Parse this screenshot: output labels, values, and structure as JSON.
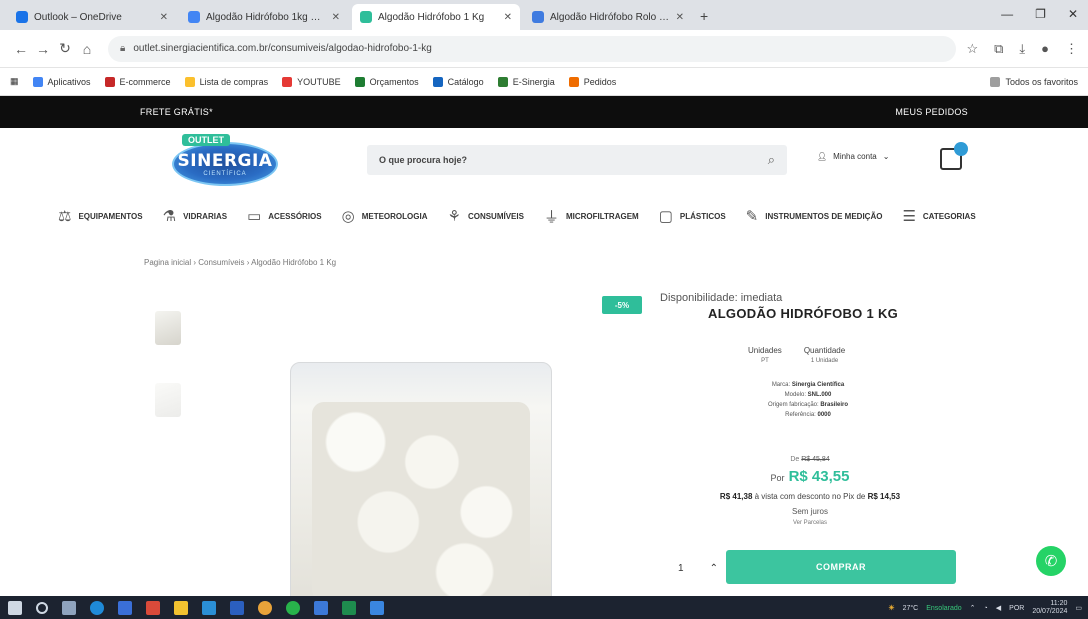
{
  "browser": {
    "tabs": [
      {
        "label": "Outlook – OneDrive",
        "color": "#1a73e8"
      },
      {
        "label": "Algodão Hidrófobo 1kg – …",
        "color": "#4285f4"
      },
      {
        "label": "Algodão Hidrófobo 1 Kg",
        "color": "#2fbe9a",
        "active": true
      },
      {
        "label": "Algodão Hidrófobo Rolo 1 …",
        "color": "#3f7be0"
      }
    ],
    "new_tab": "+",
    "url": "outlet.sinergiacientifica.com.br/consumiveis/algodao-hidrofobo-1-kg",
    "bookmarks": [
      {
        "label": "Aplicativos",
        "color": "#4285f4"
      },
      {
        "label": "E-commerce",
        "color": "#c62828"
      },
      {
        "label": "Lista de compras",
        "color": "#fbc02d"
      },
      {
        "label": "YOUTUBE",
        "color": "#e53935"
      },
      {
        "label": "Orçamentos",
        "color": "#1e7d32"
      },
      {
        "label": "Catálogo",
        "color": "#1565c0"
      },
      {
        "label": "E-Sinergia",
        "color": "#2e7d32"
      },
      {
        "label": "Pedidos",
        "color": "#ef6c00"
      },
      {
        "label": "Todos os favoritos",
        "color": "#9e9e9e"
      }
    ]
  },
  "promo": {
    "left": "FRETE GRÁTIS*",
    "right": "MEUS PEDIDOS"
  },
  "header": {
    "logo_tag": "OUTLET",
    "logo_name": "SINERGIA",
    "logo_sub": "CIENTÍFICA",
    "search_placeholder": "O que procura hoje?",
    "account": "Minha conta"
  },
  "nav": [
    {
      "icon": "equipment-icon",
      "glyph": "⚖",
      "label": "EQUIPAMENTOS"
    },
    {
      "icon": "glassware-icon",
      "glyph": "⚗",
      "label": "VIDRARIAS"
    },
    {
      "icon": "accessories-icon",
      "glyph": "▭",
      "label": "ACESSÓRIOS"
    },
    {
      "icon": "filtration-icon",
      "glyph": "◎",
      "label": "METEOROLOGIA"
    },
    {
      "icon": "consumables-icon",
      "glyph": "⚘",
      "label": "CONSUMÍVEIS"
    },
    {
      "icon": "flow-icon",
      "glyph": "⏚",
      "label": "MICROFILTRAGEM"
    },
    {
      "icon": "plastics-icon",
      "glyph": "▢",
      "label": "PLÁSTICOS"
    },
    {
      "icon": "instruments-icon",
      "glyph": "✎",
      "label": "INSTRUMENTOS DE MEDIÇÃO"
    },
    {
      "icon": "menu-icon",
      "glyph": "☰",
      "label": "CATEGORIAS"
    }
  ],
  "breadcrumb": "Pagina inicial › Consumíveis › Algodão Hidrófobo 1 Kg",
  "badge": "-5%",
  "product": {
    "availability": "Disponibilidade: imediata",
    "title": "ALGODÃO HIDRÓFOBO 1 KG",
    "unit_label": "Unidades",
    "unit_value": "PT",
    "qty_label": "Quantidade",
    "qty_value": "1 Unidade",
    "specs": [
      {
        "k": "Marca:",
        "v": "Sinergia Científica"
      },
      {
        "k": "Modelo:",
        "v": "SNL.000"
      },
      {
        "k": "Origem fabricação:",
        "v": "Brasileiro"
      },
      {
        "k": "Referência:",
        "v": "0000"
      }
    ],
    "old_price_label": "De",
    "old_price": "R$ 45,84",
    "price_label": "Por",
    "price": "R$ 43,55",
    "pix_price": "R$ 41,38",
    "pix_text": "à vista com desconto no Pix de",
    "pix_discount": "R$ 14,53",
    "installments": "Sem juros",
    "installments_link": "Ver Parcelas",
    "quantity": "1",
    "buy_label": "COMPRAR"
  },
  "taskbar": {
    "weather": "27°C",
    "weather_text": "Ensolarado",
    "time": "11:20",
    "date": "20/07/2024",
    "lang": "POR"
  }
}
